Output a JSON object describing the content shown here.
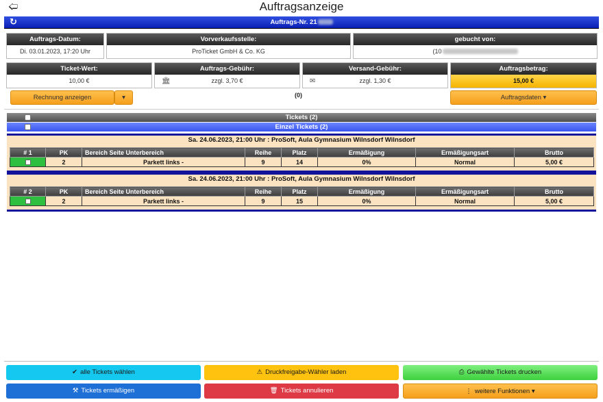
{
  "header": {
    "title": "Auftragsanzeige",
    "back_icon": "arrow-left-icon",
    "refresh_icon": "refresh-icon"
  },
  "order": {
    "number_label": "Auftrags-Nr. 21"
  },
  "info_row1": [
    {
      "label": "Auftrags-Datum:",
      "value": "Di. 03.01.2023, 17:20 Uhr"
    },
    {
      "label": "Vorverkaufsstelle:",
      "value": "ProTicket GmbH & Co. KG"
    },
    {
      "label": "gebucht von:",
      "value": "(10"
    }
  ],
  "info_row2": [
    {
      "label": "Ticket-Wert:",
      "value": "10,00 €"
    },
    {
      "label": "Auftrags-Gebühr:",
      "value": "zzgl. 3,70 €",
      "icon": "bank-icon"
    },
    {
      "label": "Versand-Gebühr:",
      "value": "zzgl. 1,30 €",
      "icon": "envelope-icon"
    },
    {
      "label": "Auftragsbetrag:",
      "value": "15,00 €"
    }
  ],
  "actions": {
    "invoice_label": "Rechnung anzeigen",
    "count": "(0)",
    "order_data_label": "Auftragsdaten ▾"
  },
  "groups": {
    "tickets_label": "Tickets (2)",
    "single_tickets_label": "Einzel Tickets (2)"
  },
  "columns": [
    "PK",
    "Bereich Seite Unterbereich",
    "Reihe",
    "Platz",
    "Ermäßigung",
    "Ermäßigungsart",
    "Brutto"
  ],
  "tickets": [
    {
      "event": "Sa. 24.06.2023, 21:00 Uhr : ProSoft, Aula Gymnasium Wilnsdorf Wilnsdorf",
      "index": "# 1",
      "pk": "2",
      "area": "Parkett links -",
      "row": "9",
      "seat": "14",
      "discount": "0%",
      "discount_type": "Normal",
      "price": "5,00 €"
    },
    {
      "event": "Sa. 24.06.2023, 21:00 Uhr : ProSoft, Aula Gymnasium Wilnsdorf Wilnsdorf",
      "index": "# 2",
      "pk": "2",
      "area": "Parkett links -",
      "row": "9",
      "seat": "15",
      "discount": "0%",
      "discount_type": "Normal",
      "price": "5,00 €"
    }
  ],
  "footer": {
    "select_all": "alle Tickets wählen",
    "load_print": "Druckfreigabe-Wähler laden",
    "print_selected": "Gewählte Tickets drucken",
    "discount": "Tickets ermäßigen",
    "cancel": "Tickets annulieren",
    "more": "weitere Funktionen ▾"
  }
}
